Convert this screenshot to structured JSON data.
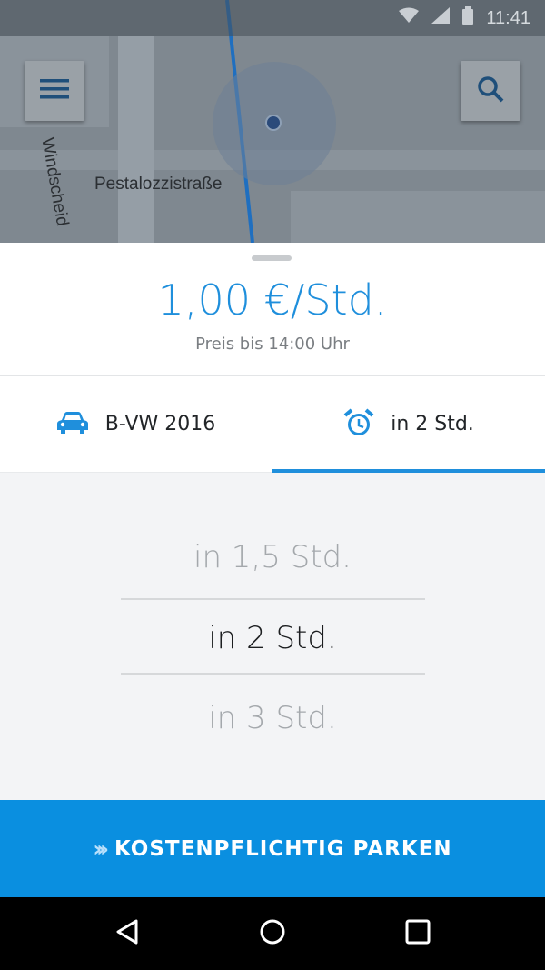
{
  "status_bar": {
    "time": "11:41"
  },
  "map": {
    "street_labels": {
      "pestalozzi": "Pestalozzistraße",
      "windscheid": "Windscheid"
    },
    "menu_icon": "hamburger-menu-icon",
    "search_icon": "search-icon"
  },
  "sheet": {
    "price": "1,00 €/Std.",
    "price_note": "Preis bis 14:00 Uhr",
    "tabs": [
      {
        "icon": "car-icon",
        "label": "B-VW 2016",
        "active": false
      },
      {
        "icon": "alarm-clock-icon",
        "label": "in 2 Std.",
        "active": true
      }
    ],
    "picker": {
      "options": [
        "in 1,5 Std.",
        "in 2 Std.",
        "in 3 Std."
      ],
      "selected": "in 2 Std."
    }
  },
  "cta": {
    "chevrons": "›››",
    "label": "KOSTENPFLICHTIG PARKEN"
  },
  "colors": {
    "accent": "#1f8fdc",
    "cta_bg": "#0a8fe0"
  }
}
